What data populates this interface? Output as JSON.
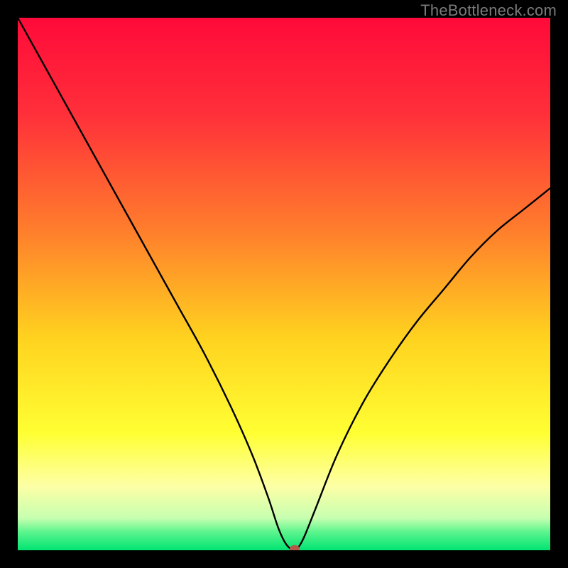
{
  "watermark": "TheBottleneck.com",
  "chart_data": {
    "type": "line",
    "title": "",
    "xlabel": "",
    "ylabel": "",
    "xlim": [
      0,
      100
    ],
    "ylim": [
      0,
      100
    ],
    "background_gradient": {
      "stops": [
        {
          "offset": 0.0,
          "color": "#ff0a3a"
        },
        {
          "offset": 0.18,
          "color": "#ff2f3a"
        },
        {
          "offset": 0.4,
          "color": "#ff7e2c"
        },
        {
          "offset": 0.6,
          "color": "#ffd21f"
        },
        {
          "offset": 0.78,
          "color": "#ffff33"
        },
        {
          "offset": 0.88,
          "color": "#fdffa6"
        },
        {
          "offset": 0.94,
          "color": "#c6ffb0"
        },
        {
          "offset": 0.965,
          "color": "#5ef58e"
        },
        {
          "offset": 1.0,
          "color": "#00e472"
        }
      ]
    },
    "series": [
      {
        "name": "bottleneck-curve",
        "color": "#000000",
        "stroke_width": 2.4,
        "x": [
          0,
          5,
          10,
          15,
          20,
          25,
          30,
          35,
          40,
          44,
          47,
          49,
          50.5,
          52,
          53,
          54,
          56,
          60,
          65,
          70,
          75,
          80,
          85,
          90,
          95,
          100
        ],
        "y": [
          100,
          91,
          82,
          73,
          64,
          55,
          46,
          37,
          27,
          18,
          10,
          4,
          1,
          0,
          1,
          3,
          8,
          18,
          28,
          36,
          43,
          49,
          55,
          60,
          64,
          68
        ]
      }
    ],
    "marker": {
      "name": "optimal-point",
      "x": 52,
      "y": 0.3,
      "rx": 7,
      "ry": 5,
      "color": "#b55a4a"
    }
  }
}
